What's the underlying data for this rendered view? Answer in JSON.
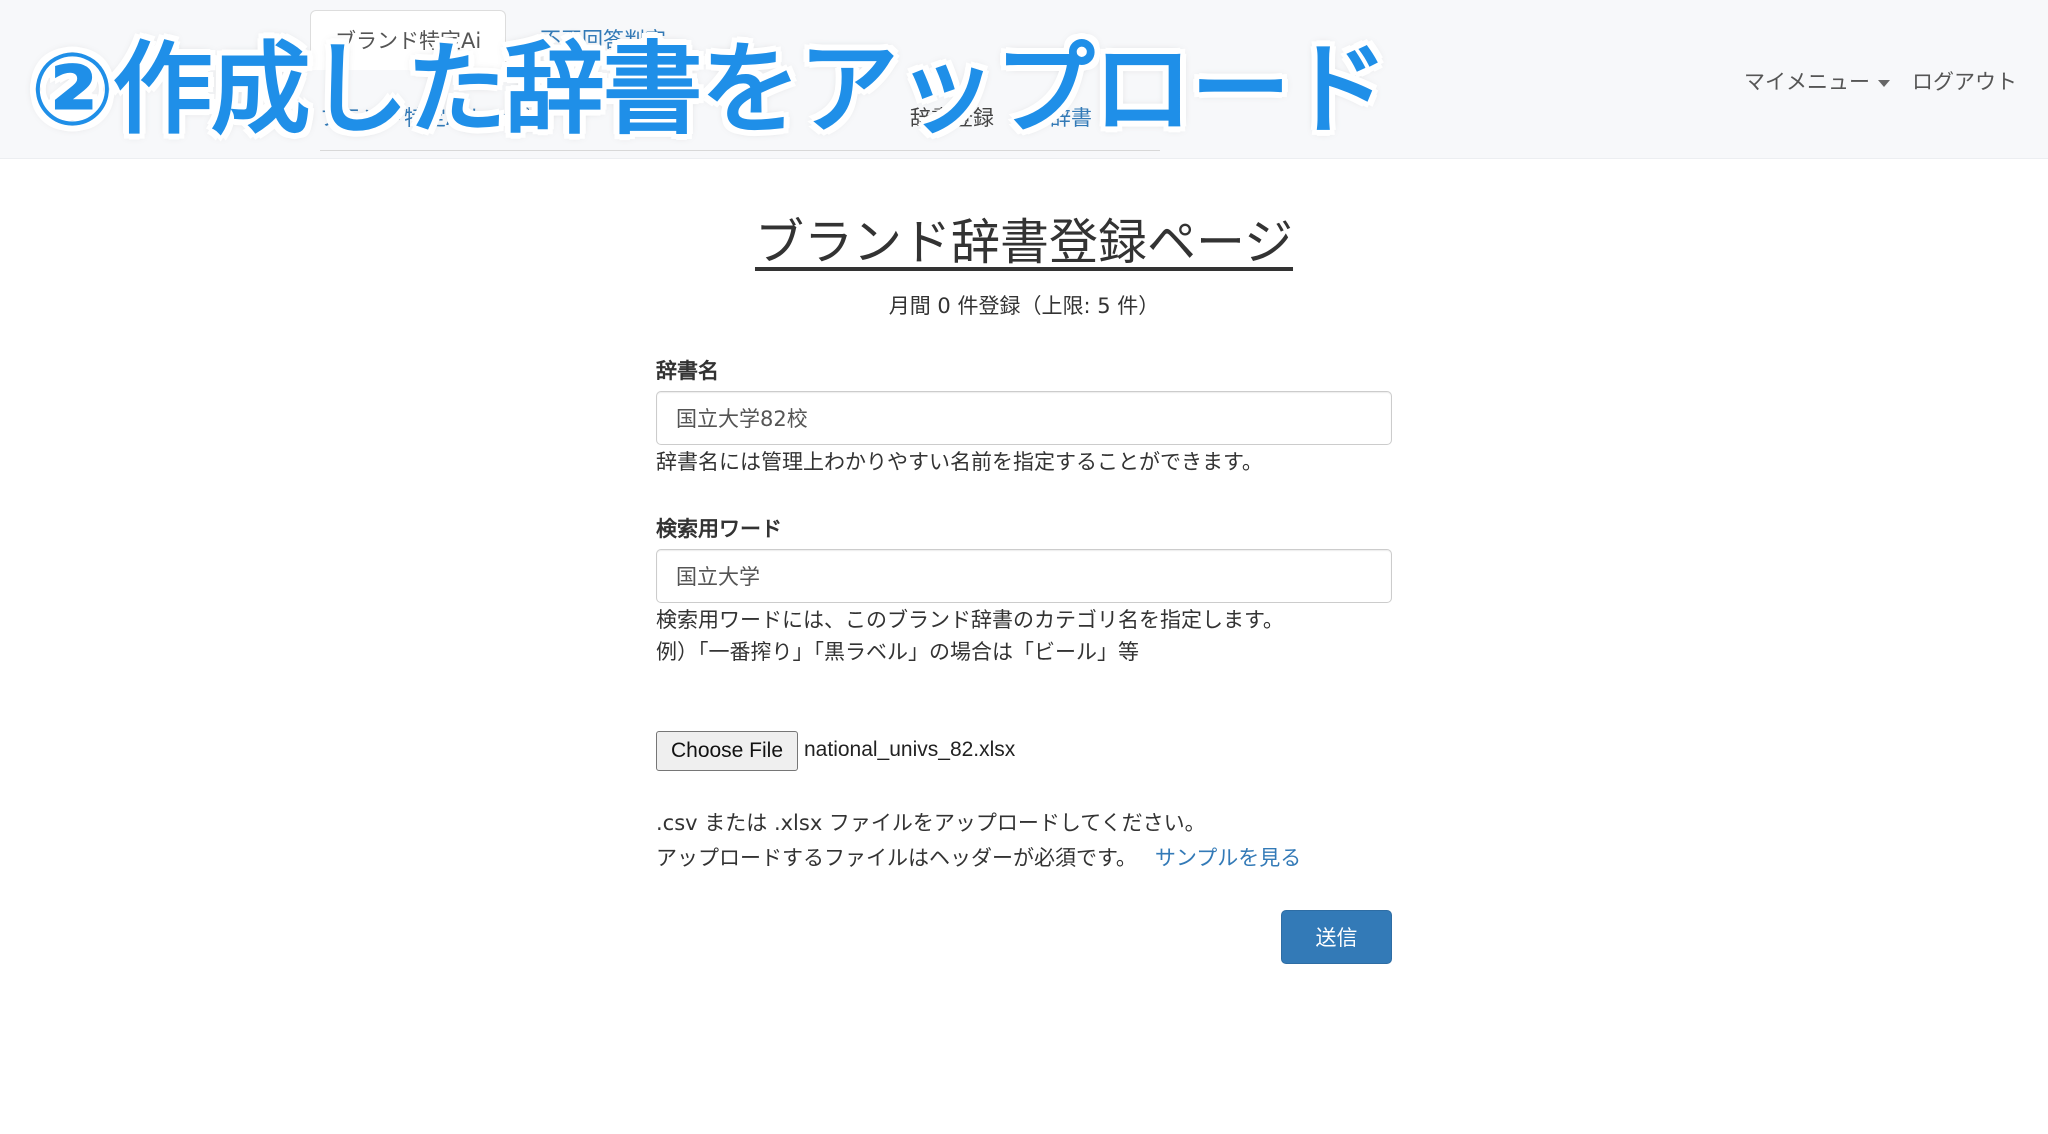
{
  "banner": {
    "text": "②作成した辞書をアップロード"
  },
  "navbar": {
    "tabs": [
      {
        "label": "ブランド特定Ai"
      },
      {
        "label": "不正回答判定"
      }
    ],
    "subnav": [
      {
        "label": "ブランド特定Aiトップ"
      },
      {
        "label": "辞書登録"
      },
      {
        "label": "辞書"
      }
    ],
    "my_menu": "マイメニュー",
    "logout": "ログアウト"
  },
  "page": {
    "title": "ブランド辞書登録ページ",
    "quota": "月間 0 件登録（上限: 5 件）"
  },
  "form": {
    "dict_name": {
      "label": "辞書名",
      "value": "国立大学82校",
      "help": "辞書名には管理上わかりやすい名前を指定することができます。"
    },
    "search_word": {
      "label": "検索用ワード",
      "value": "国立大学",
      "help_1": "検索用ワードには、このブランド辞書のカテゴリ名を指定します。",
      "help_2": "例）「一番搾り」「黒ラベル」の場合は「ビール」等"
    },
    "file": {
      "button": "Choose File",
      "filename": "national_univs_82.xlsx",
      "help_1": ".csv または .xlsx ファイルをアップロードしてください。",
      "help_2": "アップロードするファイルはヘッダーが必須です。",
      "sample_link": "サンプルを見る"
    },
    "submit": "送信"
  },
  "colors": {
    "accent": "#337ab7",
    "banner": "#1f8fe8"
  }
}
